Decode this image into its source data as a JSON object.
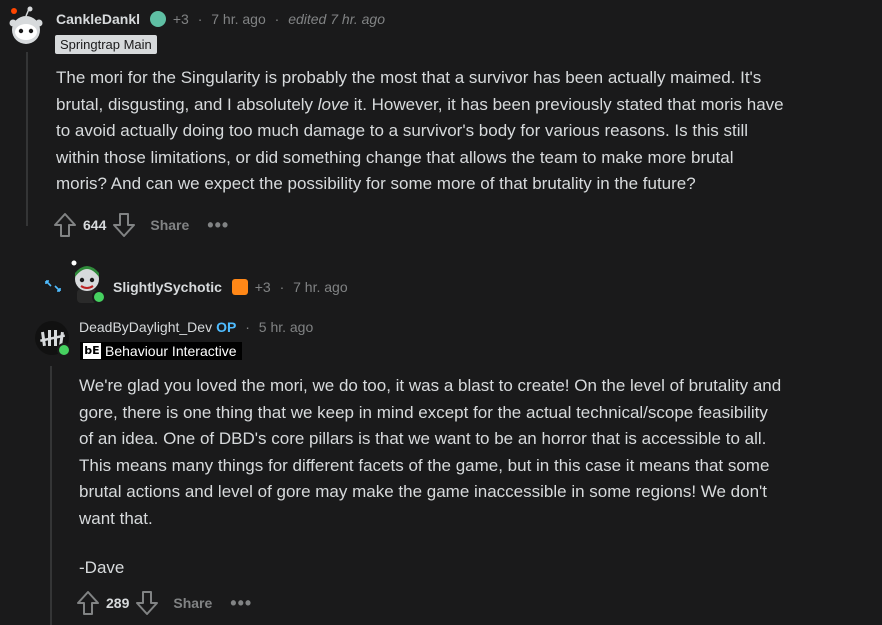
{
  "comment1": {
    "username": "CankleDankl",
    "karma_badge": "+3",
    "time": "7 hr. ago",
    "edited": "edited 7 hr. ago",
    "flair": "Springtrap Main",
    "body": "The mori for the Singularity is probably the most that a survivor has been actually maimed. It's brutal, disgusting, and I absolutely love it. However, it has been previously stated that moris have to avoid actually doing too much damage to a survivor's body for various reasons. Is this still within those limitations, or did something change that allows the team to make more brutal moris? And can we expect the possibility for some more of that brutality in the future?",
    "body_line1": "The mori for the Singularity is probably the most that a survivor has been actually maimed. It's",
    "body_line2_pre": "brutal, disgusting, and I absolutely ",
    "body_line2_em": "love",
    "body_line2_post": " it. However, it has been previously stated that moris have",
    "body_line3": "to avoid actually doing too much damage to a survivor's body for various reasons. Is this still",
    "body_line4": "within those limitations, or did something change that allows the team to make more brutal",
    "body_line5": "moris? And can we expect the possibility for some more of that brutality in the future?",
    "votes": "644",
    "share_label": "Share",
    "more_label": "•••"
  },
  "collapsed": {
    "username": "SlightlySychotic",
    "karma_badge": "+3",
    "time": "7 hr. ago"
  },
  "comment2": {
    "username": "DeadByDaylight_Dev",
    "op_label": "OP",
    "time": "5 hr. ago",
    "flair_logo": "bE",
    "flair": "Behaviour Interactive",
    "body_lines": [
      "We're glad you loved the mori, we do too, it was a blast to create! On the level of brutality and",
      "gore, there is one thing that we keep in mind except for the actual technical/scope feasibility",
      "of an idea. One of DBD's core pillars is that we want to be an horror that is accessible to all.",
      "This means many things for different facets of the game, but in this case it means that some",
      "brutal actions and level of gore may make the game inaccessible in some regions! We don't",
      "want that."
    ],
    "signature": "-Dave",
    "votes": "289",
    "share_label": "Share",
    "more_label": "•••"
  },
  "colors": {
    "background": "#1a1a1b",
    "text": "#d7dadc",
    "meta": "#818384",
    "op": "#4fbcff",
    "online": "#46d160"
  },
  "icons": [
    "reddit-snoo-avatar",
    "upvote-arrow",
    "downvote-arrow",
    "expand-arrows",
    "dbd-logo-avatar"
  ]
}
